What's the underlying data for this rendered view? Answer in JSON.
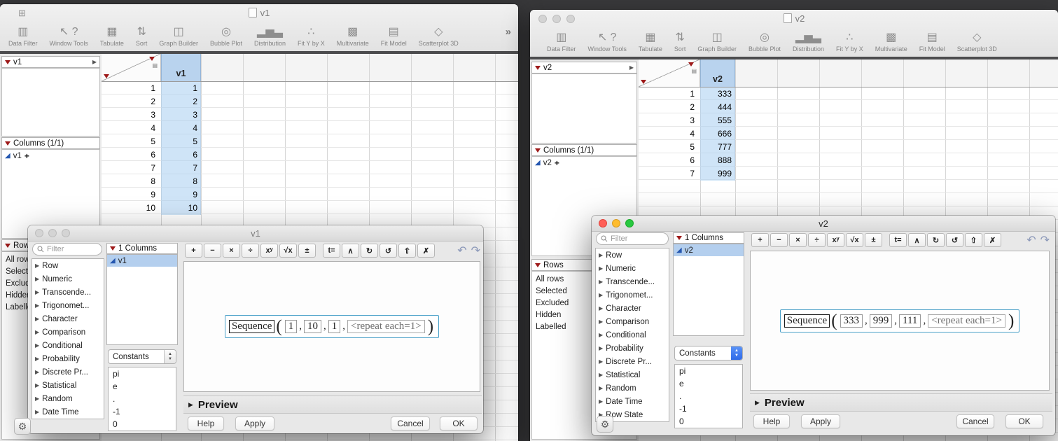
{
  "chrome": {
    "overflow": "»",
    "stepper_up": "▲",
    "stepper_down": "▼"
  },
  "toolbar_items": [
    {
      "label": "Data Filter",
      "icon": "data-filter-icon",
      "glyph": "▥"
    },
    {
      "label": "Window Tools",
      "icon": "window-tools-icon",
      "glyph": "↖ ?"
    },
    {
      "label": "Tabulate",
      "icon": "tabulate-icon",
      "glyph": "▦"
    },
    {
      "label": "Sort",
      "icon": "sort-icon",
      "glyph": "⇅"
    },
    {
      "label": "Graph Builder",
      "icon": "graph-builder-icon",
      "glyph": "◫"
    },
    {
      "label": "Bubble Plot",
      "icon": "bubble-plot-icon",
      "glyph": "◎"
    },
    {
      "label": "Distribution",
      "icon": "distribution-icon",
      "glyph": "▂▅▃"
    },
    {
      "label": "Fit Y by X",
      "icon": "fit-y-by-x-icon",
      "glyph": "∴"
    },
    {
      "label": "Multivariate",
      "icon": "multivariate-icon",
      "glyph": "▩"
    },
    {
      "label": "Fit Model",
      "icon": "fit-model-icon",
      "glyph": "▤"
    },
    {
      "label": "Scatterplot 3D",
      "icon": "scatterplot-3d-icon",
      "glyph": "◇"
    }
  ],
  "fx_buttons": [
    {
      "icon": "plus-icon",
      "glyph": "+"
    },
    {
      "icon": "minus-icon",
      "glyph": "−"
    },
    {
      "icon": "multiply-icon",
      "glyph": "×"
    },
    {
      "icon": "divide-icon",
      "glyph": "÷"
    },
    {
      "icon": "power-icon",
      "glyph": "xʸ"
    },
    {
      "icon": "root-icon",
      "glyph": "√x"
    },
    {
      "icon": "plus-minus-icon",
      "glyph": "±"
    },
    {
      "icon": "local-variable-icon",
      "glyph": "t="
    },
    {
      "icon": "insert-icon",
      "glyph": "∧"
    },
    {
      "icon": "rotate-cw-icon",
      "glyph": "↻"
    },
    {
      "icon": "rotate-ccw-icon",
      "glyph": "↺"
    },
    {
      "icon": "peel-icon",
      "glyph": "⇧"
    },
    {
      "icon": "delete-icon",
      "glyph": "✗"
    }
  ],
  "fx_history": [
    {
      "icon": "undo-icon",
      "glyph": "↶"
    },
    {
      "icon": "redo-icon",
      "glyph": "↷"
    }
  ],
  "windows": {
    "left": {
      "title": "v1",
      "table_name": "v1",
      "columns_header": "Columns (1/1)",
      "column_item": "v1",
      "add_glyph": "+",
      "rows_header": "Rows",
      "rows_items": [
        "All rows",
        "Selected",
        "Excluded",
        "Hidden",
        "Labelled"
      ],
      "grid": {
        "column": "v1",
        "rows": [
          {
            "n": "1",
            "v": "1"
          },
          {
            "n": "2",
            "v": "2"
          },
          {
            "n": "3",
            "v": "3"
          },
          {
            "n": "4",
            "v": "4"
          },
          {
            "n": "5",
            "v": "5"
          },
          {
            "n": "6",
            "v": "6"
          },
          {
            "n": "7",
            "v": "7"
          },
          {
            "n": "8",
            "v": "8"
          },
          {
            "n": "9",
            "v": "9"
          },
          {
            "n": "10",
            "v": "10"
          }
        ]
      },
      "dialog": {
        "title": "v1",
        "filter_placeholder": "Filter",
        "functions": [
          "Row",
          "Numeric",
          "Transcende...",
          "Trigonomet...",
          "Character",
          "Comparison",
          "Conditional",
          "Probability",
          "Discrete Pr...",
          "Statistical",
          "Random",
          "Date Time"
        ],
        "columns_header": "1 Columns",
        "column_name": "v1",
        "constants_label": "Constants",
        "constants": [
          "pi",
          "e",
          ".",
          "-1",
          "0"
        ],
        "formula": {
          "function": "Sequence",
          "args": [
            {
              "v": "1",
              "muted": false
            },
            {
              "v": "10",
              "muted": false
            },
            {
              "v": "1",
              "muted": false
            },
            {
              "v": "<repeat each=1>",
              "muted": true
            }
          ]
        },
        "preview_label": "Preview",
        "buttons": {
          "help": "Help",
          "apply": "Apply",
          "cancel": "Cancel",
          "ok": "OK"
        }
      }
    },
    "right": {
      "title": "v2",
      "table_name": "v2",
      "columns_header": "Columns (1/1)",
      "column_item": "v2",
      "add_glyph": "+",
      "rows_header": "Rows",
      "rows_items": [
        "All rows",
        "Selected",
        "Excluded",
        "Hidden",
        "Labelled"
      ],
      "grid": {
        "column": "v2",
        "rows": [
          {
            "n": "1",
            "v": "333"
          },
          {
            "n": "2",
            "v": "444"
          },
          {
            "n": "3",
            "v": "555"
          },
          {
            "n": "4",
            "v": "666"
          },
          {
            "n": "5",
            "v": "777"
          },
          {
            "n": "6",
            "v": "888"
          },
          {
            "n": "7",
            "v": "999"
          }
        ]
      },
      "dialog": {
        "title": "v2",
        "filter_placeholder": "Filter",
        "functions": [
          "Row",
          "Numeric",
          "Transcende...",
          "Trigonomet...",
          "Character",
          "Comparison",
          "Conditional",
          "Probability",
          "Discrete Pr...",
          "Statistical",
          "Random",
          "Date Time",
          "Row State"
        ],
        "columns_header": "1 Columns",
        "column_name": "v2",
        "constants_label": "Constants",
        "constants": [
          "pi",
          "e",
          ".",
          "-1",
          "0"
        ],
        "formula": {
          "function": "Sequence",
          "args": [
            {
              "v": "333",
              "muted": false
            },
            {
              "v": "999",
              "muted": false
            },
            {
              "v": "111",
              "muted": false
            },
            {
              "v": "<repeat each=1>",
              "muted": true
            }
          ]
        },
        "preview_label": "Preview",
        "buttons": {
          "help": "Help",
          "apply": "Apply",
          "cancel": "Cancel",
          "ok": "OK"
        }
      }
    }
  }
}
